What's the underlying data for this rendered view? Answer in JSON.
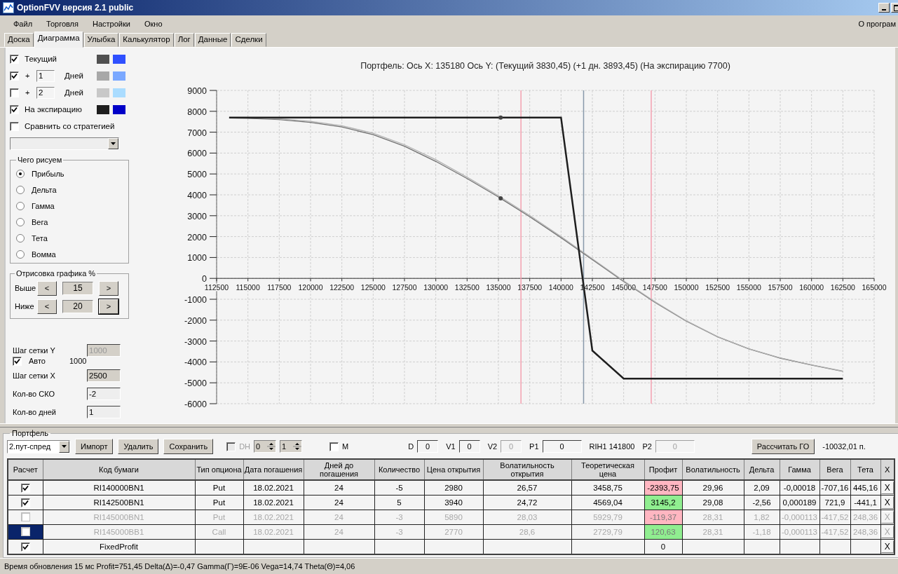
{
  "window": {
    "title": "OptionFVV версия 2.1 public"
  },
  "menu": [
    "Файл",
    "Торговля",
    "Настройки",
    "Окно"
  ],
  "menu_right": "О програм",
  "tabs": [
    {
      "label": "Доска",
      "selected": false
    },
    {
      "label": "Диаграмма",
      "selected": true
    },
    {
      "label": "Улыбка",
      "selected": false
    },
    {
      "label": "Калькулятор",
      "selected": false
    },
    {
      "label": "Лог",
      "selected": false
    },
    {
      "label": "Данные",
      "selected": false
    },
    {
      "label": "Сделки",
      "selected": false
    }
  ],
  "diagram_settings": {
    "series_toggles": [
      {
        "kind": "plain",
        "label": "Текущий",
        "checked": true,
        "swatches": [
          {
            "color": "#505050"
          },
          {
            "color": "#2f50ff"
          }
        ]
      },
      {
        "kind": "days",
        "prefix": "+",
        "days": "1",
        "label": "Дней",
        "checked": true,
        "swatches": [
          {
            "color": "#a8a8a8"
          },
          {
            "color": "#7aa8ff"
          }
        ]
      },
      {
        "kind": "days",
        "prefix": "+",
        "days": "2",
        "label": "Дней",
        "checked": false,
        "swatches": [
          {
            "color": "#c8c8c8"
          },
          {
            "color": "#aadcff"
          }
        ]
      },
      {
        "kind": "plain",
        "label": "На экспирацию",
        "checked": true,
        "swatches": [
          {
            "color": "#1e1e1e"
          },
          {
            "color": "#0000c8"
          }
        ]
      },
      {
        "kind": "plain",
        "label": "Сравнить со стратегией",
        "checked": false
      }
    ],
    "plot_group": {
      "title": "Чего рисуем",
      "options": [
        {
          "label": "Прибыль",
          "selected": true
        },
        {
          "label": "Дельта",
          "selected": false
        },
        {
          "label": "Гамма",
          "selected": false
        },
        {
          "label": "Вега",
          "selected": false
        },
        {
          "label": "Тета",
          "selected": false
        },
        {
          "label": "Вомма",
          "selected": false
        }
      ]
    },
    "range_group": {
      "title": "Отрисовка графика %",
      "rows": [
        {
          "label": "Выше",
          "value": "15",
          "left": "<",
          "right": ">"
        },
        {
          "label": "Ниже",
          "value": "20",
          "left": "<",
          "right": ">"
        }
      ]
    },
    "grid_y": {
      "label": "Шаг сетки Y",
      "value": "1000",
      "disabled": true
    },
    "auto": {
      "label": "Авто",
      "checked": true,
      "value": "1000"
    },
    "grid_x": {
      "label": "Шаг сетки X",
      "value": "2500"
    },
    "sko": {
      "label": "Кол-во СКО",
      "value": "-2"
    },
    "days": {
      "label": "Кол-во дней",
      "value": "1"
    }
  },
  "chart": {
    "title": "Портфель:  Ось X:  135180  Ось Y:   (Текущий 3830,45)   (+1 дн. 3893,45)   (На экспирацию 7700)",
    "chart_data": {
      "type": "line",
      "x": [
        113500,
        115000,
        117500,
        120000,
        122500,
        125000,
        127500,
        130000,
        132500,
        135000,
        135180,
        137500,
        140000,
        142500,
        145000,
        147500,
        150000,
        152500,
        155000,
        157500,
        160000,
        162500
      ],
      "series": [
        {
          "color": "#707070",
          "values": [
            7680,
            7660,
            7600,
            7470,
            7250,
            6880,
            6330,
            5600,
            4780,
            3900,
            3830,
            2950,
            1950,
            900,
            -150,
            -1150,
            -2050,
            -2800,
            -3380,
            -3820,
            -4150,
            -4450
          ]
        },
        {
          "color": "#b0b0b0",
          "values": [
            7700,
            7690,
            7640,
            7520,
            7310,
            6950,
            6400,
            5680,
            4850,
            3960,
            3893,
            3010,
            2000,
            940,
            -120,
            -1120,
            -2030,
            -2790,
            -3370,
            -3810,
            -4140,
            -4440
          ]
        },
        {
          "color": "#1e1e1e",
          "values": [
            7700,
            7700,
            7700,
            7700,
            7700,
            7700,
            7700,
            7700,
            7700,
            7700,
            7700,
            7700,
            7700,
            -3460,
            -4800,
            -4800,
            -4800,
            -4800,
            -4800,
            -4800,
            -4800,
            -4800
          ]
        },
        {
          "color": "#444444",
          "marker": "circle",
          "values": [
            null,
            null,
            null,
            null,
            null,
            null,
            null,
            null,
            null,
            null,
            7700,
            null,
            null,
            null,
            null,
            null,
            null,
            null,
            null,
            null,
            null,
            null
          ]
        },
        {
          "color": "#444444",
          "marker": "circle",
          "values": [
            null,
            null,
            null,
            null,
            null,
            null,
            null,
            null,
            null,
            null,
            3830,
            null,
            null,
            null,
            null,
            null,
            null,
            null,
            null,
            null,
            null,
            null
          ]
        }
      ],
      "grid": true,
      "xlim": [
        112500,
        165000
      ],
      "ylim": [
        -6000,
        9000
      ],
      "xticks": [
        112500,
        115000,
        117500,
        120000,
        122500,
        125000,
        127500,
        130000,
        132500,
        135000,
        137500,
        140000,
        142500,
        145000,
        147500,
        150000,
        152500,
        155000,
        157500,
        160000,
        162500,
        165000
      ],
      "yticks": [
        -6000,
        -5000,
        -4000,
        -3000,
        -2000,
        -1000,
        0,
        1000,
        2000,
        3000,
        4000,
        5000,
        6000,
        7000,
        8000,
        9000
      ],
      "ref_lines": [
        {
          "axis": "x",
          "value": 136800,
          "color": "#f4a0b0"
        },
        {
          "axis": "x",
          "value": 141800,
          "color": "#8899aa"
        },
        {
          "axis": "x",
          "value": 147200,
          "color": "#f4a0b0"
        }
      ]
    }
  },
  "portfolio": {
    "title": "Портфель",
    "strategy": "2.пут-спред",
    "buttons": [
      "Импорт",
      "Удалить",
      "Сохранить"
    ],
    "dh": {
      "label": "DH",
      "checked": false,
      "disabled": true
    },
    "spinners": [
      "0",
      "1"
    ],
    "m": {
      "label": "M",
      "checked": false
    },
    "fields": [
      {
        "label": "D",
        "value": "0",
        "disabled": false
      },
      {
        "label": "V1",
        "value": "0",
        "disabled": false
      },
      {
        "label": "V2",
        "value": "0",
        "disabled": true
      },
      {
        "label": "P1",
        "value": "0",
        "disabled": false
      }
    ],
    "underlying": "RIH1 141800",
    "p2": {
      "label": "P2",
      "value": "0",
      "disabled": true
    },
    "calc_button": "Рассчитать ГО",
    "margin": "-10032,01 п."
  },
  "table": {
    "columns": [
      "Расчет",
      "Код бумаги",
      "Тип опциона",
      "Дата погашения",
      "Дней до погашения",
      "Количество",
      "Цена открытия",
      "Волатильность открытия",
      "Теоретическая цена",
      "Профит",
      "Волатильность",
      "Дельта",
      "Гамма",
      "Вега",
      "Тета",
      "X"
    ],
    "rows": [
      {
        "checked": true,
        "selected": false,
        "color": "#ffb6c1",
        "cells": [
          null,
          "RI140000BN1",
          "Put",
          "18.02.2021",
          "24",
          "-5",
          "2980",
          "26,57",
          "3458,75",
          "-2393,75",
          "29,96",
          "2,09",
          "-0,00018",
          "-707,16",
          "445,16",
          "X"
        ]
      },
      {
        "checked": true,
        "selected": false,
        "color": "#90ee90",
        "cells": [
          null,
          "RI142500BN1",
          "Put",
          "18.02.2021",
          "24",
          "5",
          "3940",
          "24,72",
          "4569,04",
          "3145,2",
          "29,08",
          "-2,56",
          "0,000189",
          "721,9",
          "-441,1",
          "X"
        ]
      },
      {
        "checked": false,
        "selected": false,
        "color": "#ffb6c1",
        "cells": [
          null,
          "RI145000BN1",
          "Put",
          "18.02.2021",
          "24",
          "-3",
          "5890",
          "28,03",
          "5929,79",
          "-119,37",
          "28,31",
          "1,82",
          "-0,000113",
          "-417,52",
          "248,36",
          "X"
        ]
      },
      {
        "checked": false,
        "selected": true,
        "color": "#90ee90",
        "cells": [
          null,
          "RI145000BB1",
          "Call",
          "18.02.2021",
          "24",
          "-3",
          "2770",
          "28,6",
          "2729,79",
          "120,63",
          "28,31",
          "-1,18",
          "-0,000113",
          "-417,52",
          "248,36",
          "X"
        ]
      },
      {
        "checked": true,
        "selected": false,
        "cells": [
          null,
          "FixedProfit",
          null,
          null,
          null,
          null,
          null,
          null,
          null,
          "0",
          null,
          null,
          null,
          null,
          null,
          "X"
        ]
      }
    ]
  },
  "status_bar": "Время обновления 15 мс  Profit=751,45 Delta(Δ)=-0,47 Gamma(Γ)=9E-06 Vega=14,74 Theta(Θ)=4,06"
}
